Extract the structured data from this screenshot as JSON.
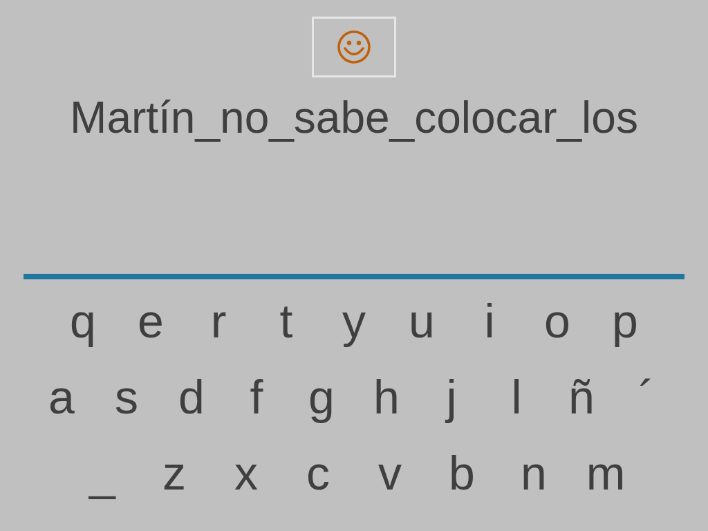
{
  "sentence": "Martín_no_sabe_colocar_los",
  "keyboard": {
    "rows": [
      [
        "q",
        "e",
        "r",
        "t",
        "y",
        "u",
        "i",
        "o",
        "p"
      ],
      [
        "a",
        "s",
        "d",
        "f",
        "g",
        "h",
        "j",
        "l",
        "ñ",
        "´"
      ],
      [
        "_",
        "z",
        "x",
        "c",
        "v",
        "b",
        "n",
        "m"
      ]
    ]
  }
}
